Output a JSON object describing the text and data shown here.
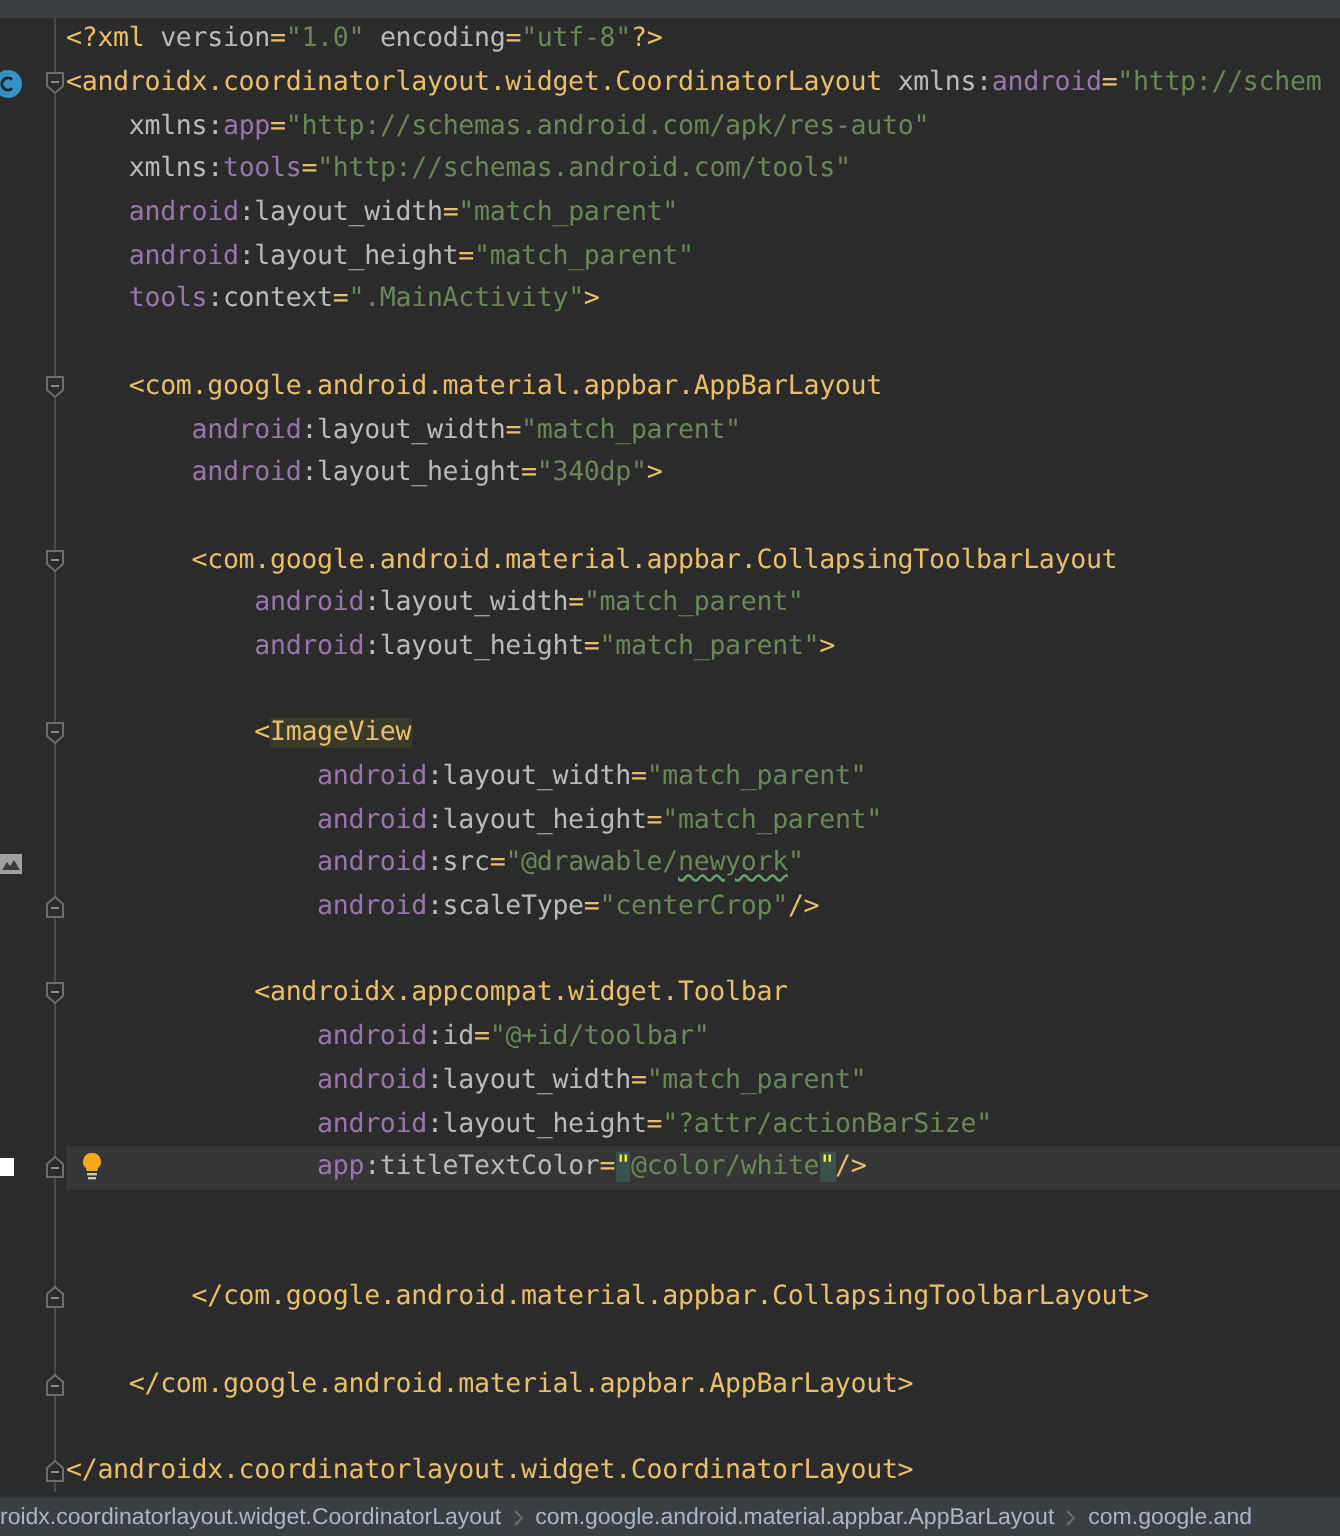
{
  "editor": {
    "lines": [
      {
        "kind": "code",
        "tokens": [
          {
            "kind": "tag",
            "text": "<?xml "
          },
          {
            "kind": "attr",
            "text": "version"
          },
          {
            "kind": "tag",
            "text": "="
          },
          {
            "kind": "value",
            "text": "\"1.0\""
          },
          {
            "kind": "attr",
            "text": " encoding"
          },
          {
            "kind": "tag",
            "text": "="
          },
          {
            "kind": "value",
            "text": "\"utf-8\""
          },
          {
            "kind": "tag",
            "text": "?>"
          }
        ]
      },
      {
        "kind": "code",
        "fold_open": true,
        "class_marker": true,
        "tokens": [
          {
            "kind": "tag",
            "text": "<androidx.coordinatorlayout.widget.CoordinatorLayout "
          },
          {
            "kind": "attr",
            "text": "xmlns:"
          },
          {
            "kind": "ns",
            "text": "android"
          },
          {
            "kind": "tag",
            "text": "="
          },
          {
            "kind": "value",
            "text": "\"http://schem"
          }
        ]
      },
      {
        "kind": "code",
        "tokens": [
          {
            "kind": "attr",
            "text": "    xmlns:"
          },
          {
            "kind": "ns",
            "text": "app"
          },
          {
            "kind": "tag",
            "text": "="
          },
          {
            "kind": "value",
            "text": "\"http://schemas.android.com/apk/res-auto\""
          }
        ]
      },
      {
        "kind": "code",
        "tokens": [
          {
            "kind": "attr",
            "text": "    xmlns:"
          },
          {
            "kind": "ns",
            "text": "tools"
          },
          {
            "kind": "tag",
            "text": "="
          },
          {
            "kind": "value",
            "text": "\"http://schemas.android.com/tools\""
          }
        ]
      },
      {
        "kind": "code",
        "tokens": [
          {
            "kind": "ns",
            "text": "    android"
          },
          {
            "kind": "attr",
            "text": ":layout_width"
          },
          {
            "kind": "tag",
            "text": "="
          },
          {
            "kind": "value",
            "text": "\"match_parent\""
          }
        ]
      },
      {
        "kind": "code",
        "tokens": [
          {
            "kind": "ns",
            "text": "    android"
          },
          {
            "kind": "attr",
            "text": ":layout_height"
          },
          {
            "kind": "tag",
            "text": "="
          },
          {
            "kind": "value",
            "text": "\"match_parent\""
          }
        ]
      },
      {
        "kind": "code",
        "tokens": [
          {
            "kind": "ns",
            "text": "    tools"
          },
          {
            "kind": "attr",
            "text": ":context"
          },
          {
            "kind": "tag",
            "text": "="
          },
          {
            "kind": "value",
            "text": "\".MainActivity\""
          },
          {
            "kind": "tag",
            "text": ">"
          }
        ]
      },
      {
        "kind": "blank"
      },
      {
        "kind": "code",
        "fold_open": true,
        "tokens": [
          {
            "kind": "tag",
            "text": "    <com.google.android.material.appbar.AppBarLayout"
          }
        ]
      },
      {
        "kind": "code",
        "tokens": [
          {
            "kind": "ns",
            "text": "        android"
          },
          {
            "kind": "attr",
            "text": ":layout_width"
          },
          {
            "kind": "tag",
            "text": "="
          },
          {
            "kind": "value",
            "text": "\"match_parent\""
          }
        ]
      },
      {
        "kind": "code",
        "tokens": [
          {
            "kind": "ns",
            "text": "        android"
          },
          {
            "kind": "attr",
            "text": ":layout_height"
          },
          {
            "kind": "tag",
            "text": "="
          },
          {
            "kind": "value",
            "text": "\"340dp\""
          },
          {
            "kind": "tag",
            "text": ">"
          }
        ]
      },
      {
        "kind": "blank"
      },
      {
        "kind": "code",
        "fold_open": true,
        "tokens": [
          {
            "kind": "tag",
            "text": "        <com.google.android.material.appbar.CollapsingToolbarLayout"
          }
        ]
      },
      {
        "kind": "code",
        "tokens": [
          {
            "kind": "ns",
            "text": "            android"
          },
          {
            "kind": "attr",
            "text": ":layout_width"
          },
          {
            "kind": "tag",
            "text": "="
          },
          {
            "kind": "value",
            "text": "\"match_parent\""
          }
        ]
      },
      {
        "kind": "code",
        "tokens": [
          {
            "kind": "ns",
            "text": "            android"
          },
          {
            "kind": "attr",
            "text": ":layout_height"
          },
          {
            "kind": "tag",
            "text": "="
          },
          {
            "kind": "value",
            "text": "\"match_parent\""
          },
          {
            "kind": "tag",
            "text": ">"
          }
        ]
      },
      {
        "kind": "blank"
      },
      {
        "kind": "code",
        "fold_open": true,
        "tokens": [
          {
            "kind": "tag",
            "text": "            <"
          },
          {
            "kind": "highlight",
            "text": "ImageView"
          }
        ]
      },
      {
        "kind": "code",
        "tokens": [
          {
            "kind": "ns",
            "text": "                android"
          },
          {
            "kind": "attr",
            "text": ":layout_width"
          },
          {
            "kind": "tag",
            "text": "="
          },
          {
            "kind": "value",
            "text": "\"match_parent\""
          }
        ]
      },
      {
        "kind": "code",
        "tokens": [
          {
            "kind": "ns",
            "text": "                android"
          },
          {
            "kind": "attr",
            "text": ":layout_height"
          },
          {
            "kind": "tag",
            "text": "="
          },
          {
            "kind": "value",
            "text": "\"match_parent\""
          }
        ]
      },
      {
        "kind": "code",
        "image_preview": true,
        "tokens": [
          {
            "kind": "ns",
            "text": "                android"
          },
          {
            "kind": "attr",
            "text": ":src"
          },
          {
            "kind": "tag",
            "text": "="
          },
          {
            "kind": "value",
            "text": "\"@drawable/"
          },
          {
            "kind": "typo",
            "text": "newyork"
          },
          {
            "kind": "value",
            "text": "\""
          }
        ]
      },
      {
        "kind": "code",
        "fold_close": true,
        "tokens": [
          {
            "kind": "ns",
            "text": "                android"
          },
          {
            "kind": "attr",
            "text": ":scaleType"
          },
          {
            "kind": "tag",
            "text": "="
          },
          {
            "kind": "value",
            "text": "\"centerCrop\""
          },
          {
            "kind": "tag",
            "text": "/>"
          }
        ]
      },
      {
        "kind": "blank"
      },
      {
        "kind": "code",
        "fold_open": true,
        "tokens": [
          {
            "kind": "tag",
            "text": "            <androidx.appcompat.widget.Toolbar"
          }
        ]
      },
      {
        "kind": "code",
        "tokens": [
          {
            "kind": "ns",
            "text": "                android"
          },
          {
            "kind": "attr",
            "text": ":id"
          },
          {
            "kind": "tag",
            "text": "="
          },
          {
            "kind": "value",
            "text": "\"@+id/toolbar\""
          }
        ]
      },
      {
        "kind": "code",
        "tokens": [
          {
            "kind": "ns",
            "text": "                android"
          },
          {
            "kind": "attr",
            "text": ":layout_width"
          },
          {
            "kind": "tag",
            "text": "="
          },
          {
            "kind": "value",
            "text": "\"match_parent\""
          }
        ]
      },
      {
        "kind": "code",
        "tokens": [
          {
            "kind": "ns",
            "text": "                android"
          },
          {
            "kind": "attr",
            "text": ":layout_height"
          },
          {
            "kind": "tag",
            "text": "="
          },
          {
            "kind": "value",
            "text": "\"?attr/actionBarSize\""
          }
        ]
      },
      {
        "kind": "code",
        "current": true,
        "fold_close": true,
        "color_preview": true,
        "intention": true,
        "tokens": [
          {
            "kind": "ns",
            "text": "                app"
          },
          {
            "kind": "attr",
            "text": ":titleTextColor"
          },
          {
            "kind": "tag",
            "text": "="
          },
          {
            "kind": "match",
            "text": "\""
          },
          {
            "kind": "value",
            "text": "@color/white"
          },
          {
            "kind": "match",
            "text": "\""
          },
          {
            "kind": "tag",
            "text": "/>"
          }
        ]
      },
      {
        "kind": "blank"
      },
      {
        "kind": "blank"
      },
      {
        "kind": "code",
        "fold_close": true,
        "tokens": [
          {
            "kind": "tag",
            "text": "        </com.google.android.material.appbar.CollapsingToolbarLayout>"
          }
        ]
      },
      {
        "kind": "blank"
      },
      {
        "kind": "code",
        "fold_close": true,
        "tokens": [
          {
            "kind": "tag",
            "text": "    </com.google.android.material.appbar.AppBarLayout>"
          }
        ]
      },
      {
        "kind": "blank"
      },
      {
        "kind": "code",
        "fold_close": true,
        "tokens": [
          {
            "kind": "tag",
            "text": "</androidx.coordinatorlayout.widget.CoordinatorLayout>"
          }
        ]
      }
    ]
  },
  "breadcrumbs": [
    "roidx.coordinatorlayout.widget.CoordinatorLayout",
    "com.google.android.material.appbar.AppBarLayout",
    "com.google.and"
  ]
}
